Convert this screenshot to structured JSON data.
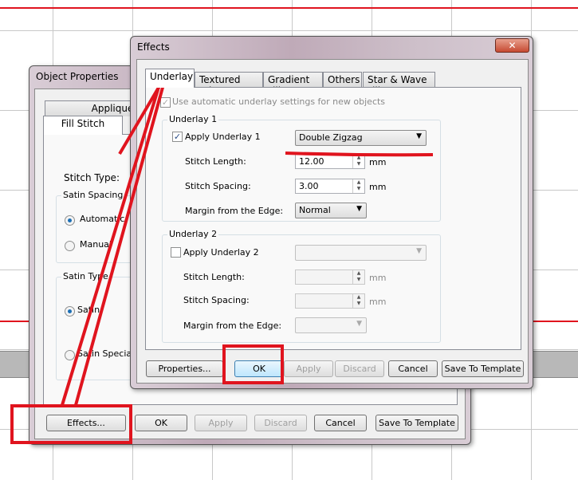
{
  "object_properties": {
    "title": "Object Properties",
    "tabs": [
      "Applique",
      "Fill Stitch"
    ],
    "stitch_type_label": "Stitch Type:",
    "satin_spacing": {
      "label": "Satin Spacing",
      "options": [
        "Automatic",
        "Manual"
      ],
      "selected": "Automatic"
    },
    "satin_type": {
      "label": "Satin Type",
      "options": [
        "Satin",
        "Satin Special"
      ],
      "selected": "Satin"
    },
    "buttons": {
      "effects": "Effects...",
      "ok": "OK",
      "apply": "Apply",
      "discard": "Discard",
      "cancel": "Cancel",
      "save_template": "Save To Template"
    }
  },
  "effects": {
    "title": "Effects",
    "close": "✕",
    "tabs": [
      "Underlay",
      "Textured Edge",
      "Gradient Fill",
      "Others",
      "Star & Wave Fill"
    ],
    "active_tab": "Underlay",
    "auto_underlay": "Use automatic underlay settings for new objects",
    "underlay1": {
      "label": "Underlay 1",
      "apply": "Apply Underlay 1",
      "checked": true,
      "type": "Double Zigzag",
      "stitch_length_label": "Stitch Length:",
      "stitch_length": "12.00",
      "stitch_spacing_label": "Stitch Spacing:",
      "stitch_spacing": "3.00",
      "unit": "mm",
      "margin_label": "Margin from the Edge:",
      "margin": "Normal"
    },
    "underlay2": {
      "label": "Underlay 2",
      "apply": "Apply Underlay 2",
      "checked": false,
      "stitch_length_label": "Stitch Length:",
      "stitch_spacing_label": "Stitch Spacing:",
      "unit": "mm",
      "margin_label": "Margin from the Edge:"
    },
    "buttons": {
      "properties": "Properties...",
      "ok": "OK",
      "apply": "Apply",
      "discard": "Discard",
      "cancel": "Cancel",
      "save_template": "Save To Template"
    }
  },
  "colors": {
    "annotation": "#e0141e",
    "default_button": "#3c7fb1"
  }
}
